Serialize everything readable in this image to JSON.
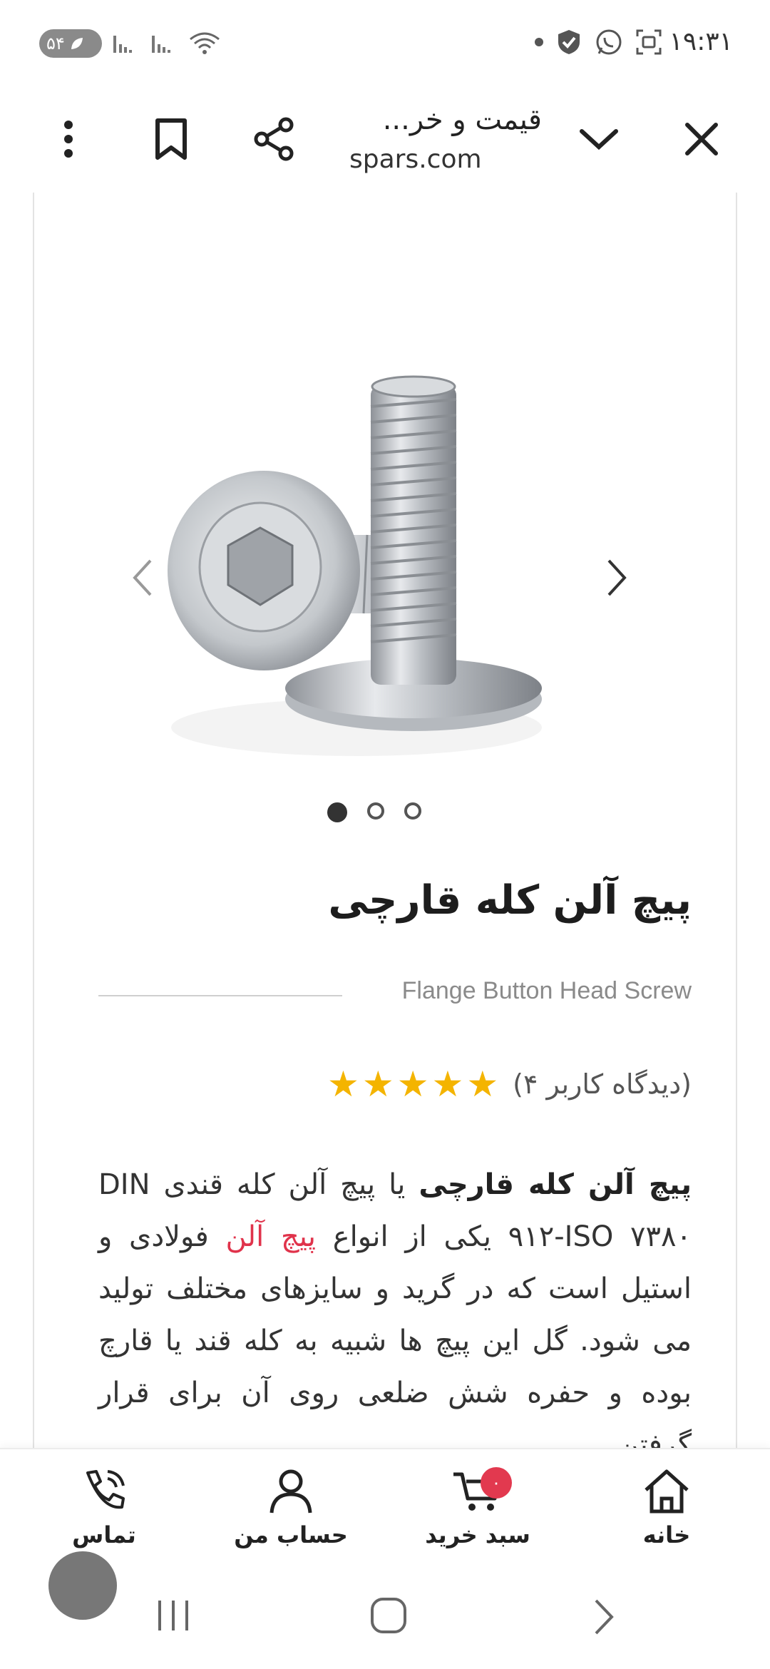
{
  "status_bar": {
    "time": "۱۹:۳۱",
    "battery": "۵۴"
  },
  "browser": {
    "page_title": "قیمت و خر...",
    "url": "spars.com"
  },
  "carousel": {
    "image_alt": "",
    "slide_count": 3,
    "active_slide": 1
  },
  "product": {
    "title": "پیچ آلن کله قارچی",
    "subtitle": "Flange Button Head Screw",
    "rating_stars": 5,
    "review_text": "(دیدگاه کاربر ۴)",
    "desc_bold": "پیچ آلن کله قارچی",
    "desc_part1": " یا پیچ آلن کله قندی DIN ۹۱۲-ISO ۷۳۸۰ یکی از انواع ",
    "desc_link": "پیچ آلن",
    "desc_part2": " فولادی و استیل است که در گرید و سایزهای مختلف تولید می شود. گل این پیچ ها شبیه به کله قند یا قارچ بوده و حفره شش ضلعی روی آن برای قرار گرفتن"
  },
  "bottom_nav": {
    "home": "خانه",
    "cart": "سبد خرید",
    "cart_count": "۰",
    "account": "حساب من",
    "contact": "تماس"
  },
  "colors": {
    "accent": "#e2394f",
    "star": "#f4b400"
  }
}
